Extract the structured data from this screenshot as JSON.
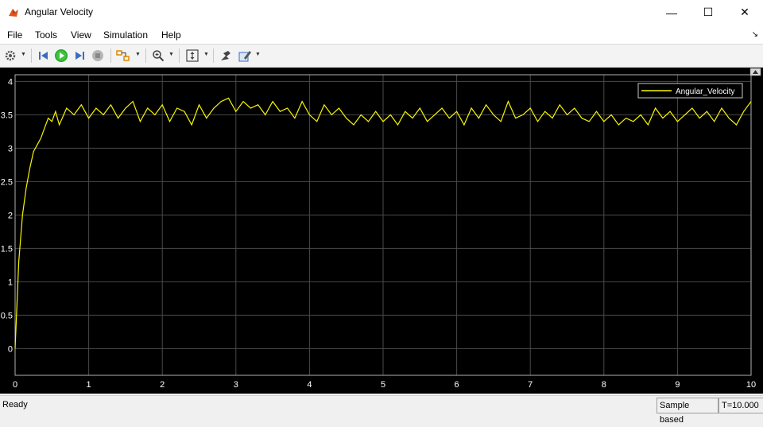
{
  "window": {
    "title": "Angular Velocity"
  },
  "title_buttons": {
    "minimize": "—",
    "maximize": "☐",
    "close": "✕"
  },
  "menu": {
    "items": [
      "File",
      "Tools",
      "View",
      "Simulation",
      "Help"
    ],
    "corner_arrow": "↘"
  },
  "toolbar": {
    "icons": [
      "gear-icon",
      "step-back-icon",
      "run-icon",
      "step-forward-icon",
      "stop-icon",
      "highlight-block-icon",
      "zoom-icon",
      "autoscale-icon",
      "axes-settings-icon",
      "style-icon"
    ]
  },
  "colors": {
    "plot_bg": "#000000",
    "line": "#f7f700",
    "grid": "#4a4a4a",
    "axis_text": "#ffffff",
    "accent_run": "#2aa52a"
  },
  "chart_data": {
    "type": "line",
    "title": "",
    "xlabel": "",
    "ylabel": "",
    "xlim": [
      0,
      10
    ],
    "ylim": [
      -0.4,
      4.1
    ],
    "xticks": [
      "0",
      "1",
      "2",
      "3",
      "4",
      "5",
      "6",
      "7",
      "8",
      "9",
      "10"
    ],
    "yticks": [
      "0",
      "0.5",
      "1",
      "1.5",
      "2",
      "2.5",
      "3",
      "3.5",
      "4"
    ],
    "grid": true,
    "legend_position": "top-right",
    "series": [
      {
        "name": "Angular_Velocity",
        "x": [
          0,
          0.05,
          0.1,
          0.15,
          0.2,
          0.25,
          0.3,
          0.35,
          0.4,
          0.45,
          0.5,
          0.55,
          0.6,
          0.7,
          0.8,
          0.9,
          1.0,
          1.1,
          1.2,
          1.3,
          1.4,
          1.5,
          1.6,
          1.7,
          1.8,
          1.9,
          2.0,
          2.1,
          2.2,
          2.3,
          2.4,
          2.5,
          2.6,
          2.7,
          2.8,
          2.9,
          3.0,
          3.1,
          3.2,
          3.3,
          3.4,
          3.5,
          3.6,
          3.7,
          3.8,
          3.9,
          4.0,
          4.1,
          4.2,
          4.3,
          4.4,
          4.5,
          4.6,
          4.7,
          4.8,
          4.9,
          5.0,
          5.1,
          5.2,
          5.3,
          5.4,
          5.5,
          5.6,
          5.7,
          5.8,
          5.9,
          6.0,
          6.1,
          6.2,
          6.3,
          6.4,
          6.5,
          6.6,
          6.7,
          6.8,
          6.9,
          7.0,
          7.1,
          7.2,
          7.3,
          7.4,
          7.5,
          7.6,
          7.7,
          7.8,
          7.9,
          8.0,
          8.1,
          8.2,
          8.3,
          8.4,
          8.5,
          8.6,
          8.7,
          8.8,
          8.9,
          9.0,
          9.1,
          9.2,
          9.3,
          9.4,
          9.5,
          9.6,
          9.7,
          9.8,
          9.9,
          10.0
        ],
        "y": [
          0,
          1.3,
          2.0,
          2.4,
          2.7,
          2.95,
          3.05,
          3.15,
          3.3,
          3.45,
          3.4,
          3.55,
          3.35,
          3.6,
          3.5,
          3.65,
          3.45,
          3.6,
          3.5,
          3.65,
          3.45,
          3.6,
          3.7,
          3.4,
          3.6,
          3.5,
          3.65,
          3.4,
          3.6,
          3.55,
          3.35,
          3.65,
          3.45,
          3.6,
          3.7,
          3.75,
          3.55,
          3.7,
          3.6,
          3.65,
          3.5,
          3.7,
          3.55,
          3.6,
          3.45,
          3.7,
          3.5,
          3.4,
          3.65,
          3.5,
          3.6,
          3.45,
          3.35,
          3.5,
          3.4,
          3.55,
          3.4,
          3.5,
          3.35,
          3.55,
          3.45,
          3.6,
          3.4,
          3.5,
          3.6,
          3.45,
          3.55,
          3.35,
          3.6,
          3.45,
          3.65,
          3.5,
          3.4,
          3.7,
          3.45,
          3.5,
          3.6,
          3.4,
          3.55,
          3.45,
          3.65,
          3.5,
          3.6,
          3.45,
          3.4,
          3.55,
          3.4,
          3.5,
          3.35,
          3.45,
          3.4,
          3.5,
          3.35,
          3.6,
          3.45,
          3.55,
          3.4,
          3.5,
          3.6,
          3.45,
          3.55,
          3.4,
          3.6,
          3.45,
          3.35,
          3.55,
          3.7
        ]
      }
    ]
  },
  "status": {
    "left": "Ready",
    "mode": "Sample based",
    "time": "T=10.000"
  }
}
